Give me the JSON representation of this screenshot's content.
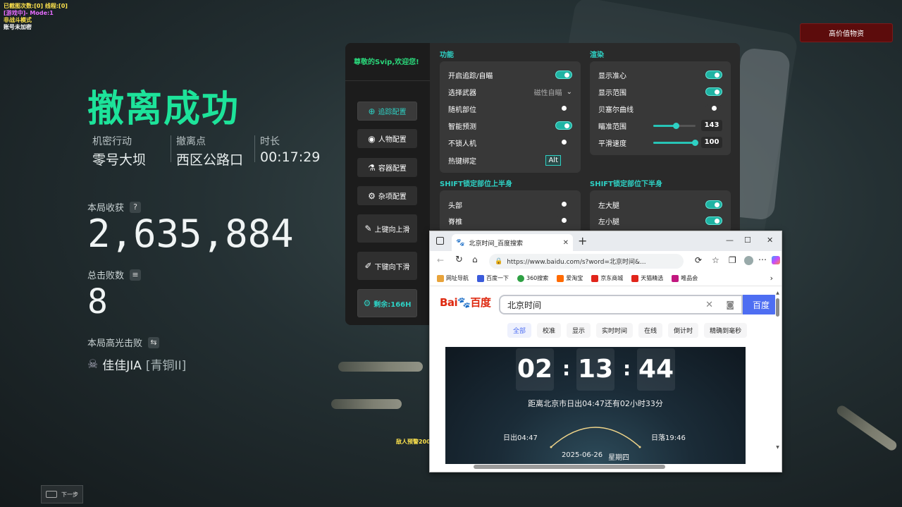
{
  "overlay": {
    "line1": "已截图次数:[0] 线程:[0]",
    "line2": "[游戏中]- Mode:1",
    "line3": "非战斗模式",
    "line4": "账号未加密",
    "enemy_warning": "敌人预警200"
  },
  "result": {
    "title": "撤离成功",
    "meta": [
      {
        "label": "机密行动",
        "value": "零号大坝"
      },
      {
        "label": "撤离点",
        "value": "西区公路口"
      },
      {
        "label": "时长",
        "value": "00:17:29"
      }
    ],
    "income_label": "本局收获",
    "income_value": "2,635,884",
    "kills_label": "总击败数",
    "kills_value": "8",
    "highlight_label": "本局高光击败",
    "highlight_player": "佳佳JIA",
    "highlight_rank": "[青铜II]",
    "next_label": "下一步"
  },
  "top_button": "高价值物资",
  "menu": {
    "welcome": "尊敬的Svip,欢迎您!",
    "side": [
      {
        "label": "追踪配置",
        "icon": "crosshair-icon",
        "active": true
      },
      {
        "label": "人物配置",
        "icon": "eye-icon",
        "active": false
      },
      {
        "label": "容器配置",
        "icon": "flask-icon",
        "active": false
      },
      {
        "label": "杂项配置",
        "icon": "gear-icon",
        "active": false
      },
      {
        "label": "上键向上滑",
        "icon": "pen-icon",
        "active": false
      },
      {
        "label": "下键向下滑",
        "icon": "brush-icon",
        "active": false
      },
      {
        "label": "剩余:166H",
        "icon": "gear-icon",
        "active": true
      }
    ],
    "function": {
      "title": "功能",
      "rows": [
        {
          "label": "开启追踪/自瞄",
          "on": true
        },
        {
          "label": "选择武器",
          "select": "磁性自瞄"
        },
        {
          "label": "随机部位",
          "on": false
        },
        {
          "label": "智能预测",
          "on": true
        },
        {
          "label": "不锁人机",
          "on": false
        },
        {
          "label": "热键绑定",
          "hotkey": "Alt"
        }
      ]
    },
    "render": {
      "title": "渲染",
      "rows": [
        {
          "label": "显示准心",
          "on": true
        },
        {
          "label": "显示范围",
          "on": true
        },
        {
          "label": "贝塞尔曲线",
          "on": false
        },
        {
          "label": "瞄准范围",
          "value": "143",
          "level": 0.55
        },
        {
          "label": "平滑速度",
          "value": "100",
          "level": 1.0
        }
      ]
    },
    "upper": {
      "title": "SHIFT锁定部位上半身",
      "rows": [
        {
          "label": "头部",
          "on": false
        },
        {
          "label": "脊椎",
          "on": false
        }
      ]
    },
    "lower": {
      "title": "SHIFT锁定部位下半身",
      "rows": [
        {
          "label": "左大腿",
          "on": true
        },
        {
          "label": "左小腿",
          "on": true
        }
      ]
    }
  },
  "browser": {
    "tab_title": "北京时间_百度搜索",
    "url": "https://www.baidu.com/s?word=北京时间&...",
    "bookmarks": [
      {
        "label": "网址导航",
        "color": "#e8a33a"
      },
      {
        "label": "百度一下",
        "color": "#3b5bdb"
      },
      {
        "label": "360搜索",
        "color": "#2ea043"
      },
      {
        "label": "爱淘宝",
        "color": "#ff6a00"
      },
      {
        "label": "京东商城",
        "color": "#e1251b"
      },
      {
        "label": "天猫精选",
        "color": "#e1251b"
      },
      {
        "label": "唯品会",
        "color": "#c2187f"
      }
    ],
    "logo_red": "Bai",
    "logo_blue": "du",
    "logo_cn": "百度",
    "search_value": "北京时间",
    "search_btn": "百度",
    "tabs": [
      "全部",
      "校准",
      "显示",
      "实时时间",
      "在线",
      "倒计时",
      "精确到毫秒"
    ],
    "clock": {
      "h": "02",
      "m": "13",
      "s": "44"
    },
    "sunrise_text": "距离北京市日出04:47还有02小时33分",
    "sunrise": "日出04:47",
    "sunset": "日落19:46",
    "date": "2025-06-26",
    "weekday": "星期四"
  }
}
